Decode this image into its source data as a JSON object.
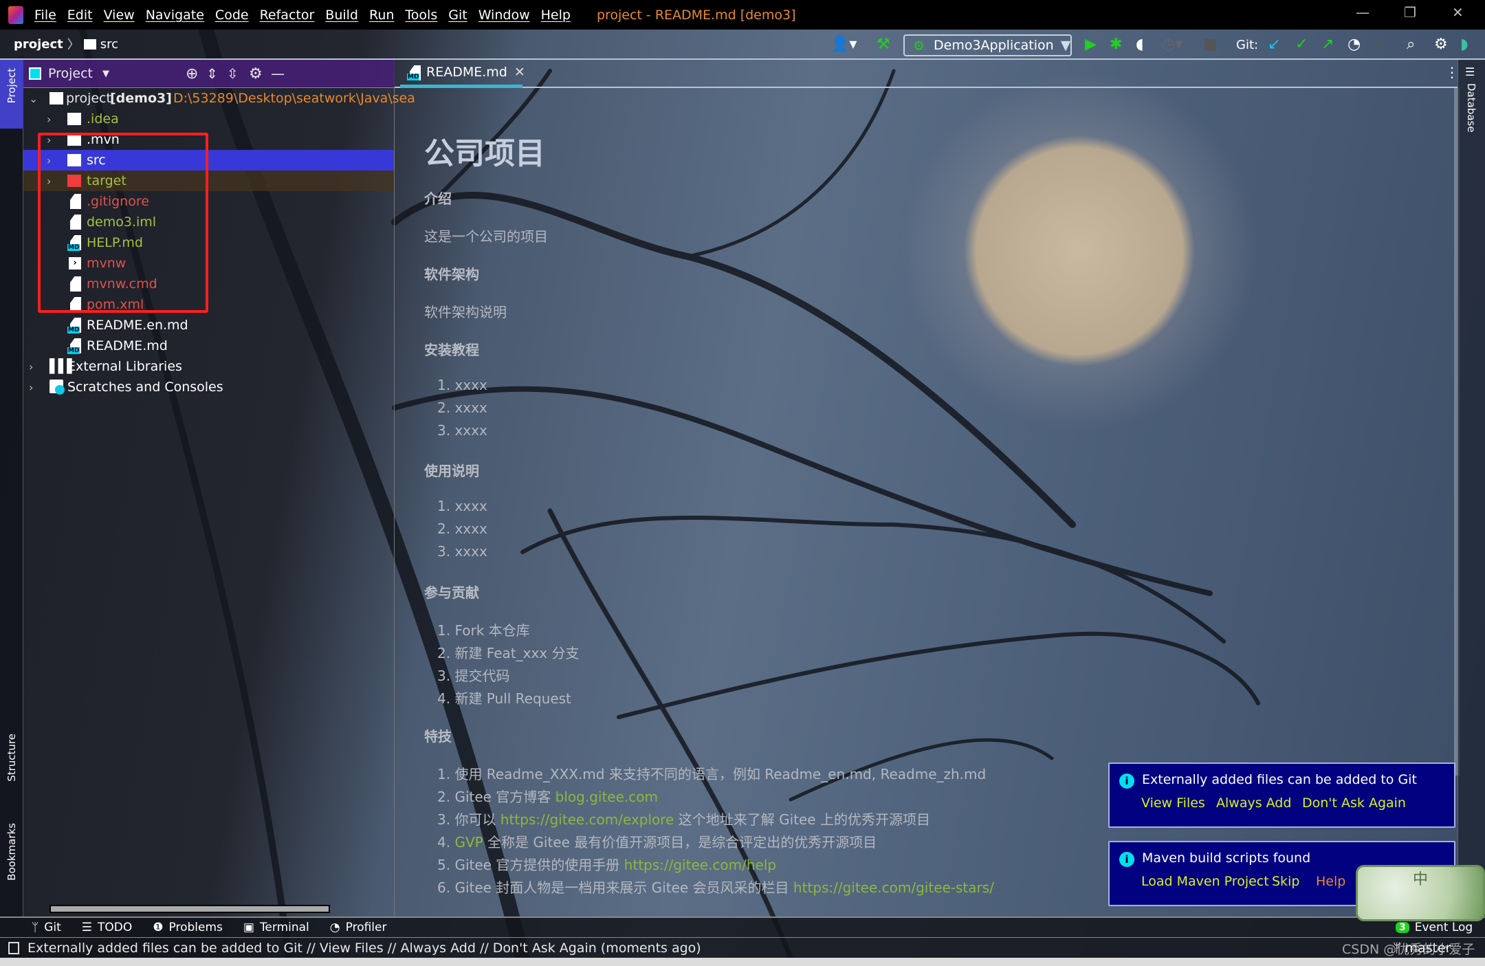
{
  "menubar": {
    "items": [
      "File",
      "Edit",
      "View",
      "Navigate",
      "Code",
      "Refactor",
      "Build",
      "Run",
      "Tools",
      "Git",
      "Window",
      "Help"
    ],
    "window_title": "project - README.md [demo3]"
  },
  "navbar": {
    "breadcrumb": [
      "project",
      "src"
    ],
    "run_config": "Demo3Application",
    "git_label": "Git:"
  },
  "tool_stripe": {
    "project": "Project",
    "structure": "Structure",
    "bookmarks": "Bookmarks",
    "database": "Database"
  },
  "project_panel": {
    "title": "Project",
    "root": {
      "name": "project",
      "module": "[demo3]",
      "path": "D:\\53289\\Desktop\\seatwork\\Java\\sea"
    },
    "items": [
      {
        "name": ".idea",
        "type": "folder",
        "color": "#a8c23a"
      },
      {
        "name": ".mvn",
        "type": "folder",
        "color": "#ffffff"
      },
      {
        "name": "src",
        "type": "folder",
        "color": "#ffffff"
      },
      {
        "name": "target",
        "type": "folder",
        "color": "#a8c23a"
      },
      {
        "name": ".gitignore",
        "type": "file",
        "color": "#e0524a"
      },
      {
        "name": "demo3.iml",
        "type": "file",
        "color": "#a8c23a"
      },
      {
        "name": "HELP.md",
        "type": "md",
        "color": "#a8c23a"
      },
      {
        "name": "mvnw",
        "type": "script",
        "color": "#e0524a"
      },
      {
        "name": "mvnw.cmd",
        "type": "file",
        "color": "#e0524a"
      },
      {
        "name": "pom.xml",
        "type": "file",
        "color": "#e0524a"
      },
      {
        "name": "README.en.md",
        "type": "md",
        "color": "#ffffff"
      },
      {
        "name": "README.md",
        "type": "md",
        "color": "#ffffff"
      }
    ],
    "external_libraries": "External Libraries",
    "scratches": "Scratches and Consoles"
  },
  "editor": {
    "tab": "README.md",
    "doc": {
      "title": "公司项目",
      "h_intro": "介绍",
      "intro": "这是一个公司的项目",
      "h_arch": "软件架构",
      "arch": "软件架构说明",
      "h_install": "安装教程",
      "install": [
        "1. xxxx",
        "2. xxxx",
        "3. xxxx"
      ],
      "h_usage": "使用说明",
      "usage": [
        "1. xxxx",
        "2. xxxx",
        "3. xxxx"
      ],
      "h_contrib": "参与贡献",
      "contrib": [
        "1. Fork 本仓库",
        "2. 新建 Feat_xxx 分支",
        "3. 提交代码",
        "4. 新建 Pull Request"
      ],
      "h_features": "特技",
      "features": [
        {
          "pre": "1. 使用 Readme_XXX.md 来支持不同的语言，例如 Readme_en.md, Readme_zh.md",
          "link": "",
          "post": ""
        },
        {
          "pre": "2. Gitee 官方博客 ",
          "link": "blog.gitee.com",
          "post": ""
        },
        {
          "pre": "3. 你可以 ",
          "link": "https://gitee.com/explore",
          "post": " 这个地址来了解 Gitee 上的优秀开源项目"
        },
        {
          "pre": "4. ",
          "link": "GVP",
          "post": " 全称是 Gitee 最有价值开源项目，是综合评定出的优秀开源项目"
        },
        {
          "pre": "5. Gitee 官方提供的使用手册 ",
          "link": "https://gitee.com/help",
          "post": ""
        },
        {
          "pre": "6. Gitee 封面人物是一档用来展示 Gitee 会员风采的栏目 ",
          "link": "https://gitee.com/gitee-stars/",
          "post": ""
        }
      ]
    }
  },
  "notifications": [
    {
      "title": "Externally added files can be added to Git",
      "actions": [
        "View Files",
        "Always Add",
        "Don't Ask Again"
      ]
    },
    {
      "title": "Maven build scripts found",
      "actions": [
        "Load Maven Project",
        "Skip",
        "Help"
      ]
    }
  ],
  "bottom_tools": [
    "Git",
    "TODO",
    "Problems",
    "Terminal",
    "Profiler"
  ],
  "event_log": {
    "count": "3",
    "label": "Event Log"
  },
  "status": {
    "message": "Externally added files can be added to Git // View Files // Always Add // Don't Ask Again (moments ago)",
    "branch": "master",
    "watermark": "CSDN @优秀的小爱子",
    "thumb_char": "中"
  },
  "colors": {
    "accent": "#3cb4d0",
    "selection": "#3838d8",
    "notification_bg": "#020280",
    "link": "#8cb83c"
  }
}
